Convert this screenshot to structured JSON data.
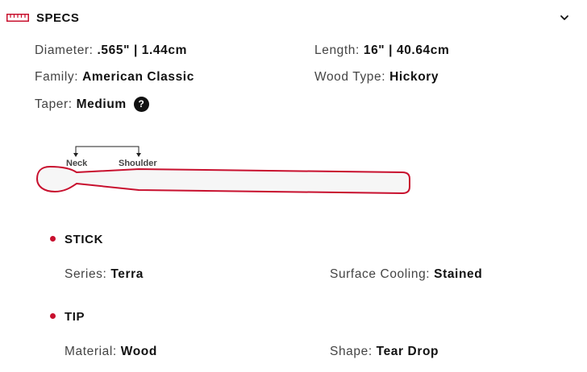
{
  "header": {
    "title": "SPECS",
    "icon": "ruler-icon",
    "toggle_icon": "chevron-down-icon",
    "accent_color": "#c8102e"
  },
  "specs": {
    "diameter": {
      "label": "Diameter:",
      "value": ".565\" | 1.44cm"
    },
    "length": {
      "label": "Length:",
      "value": "16\" | 40.64cm"
    },
    "family": {
      "label": "Family:",
      "value": "American Classic"
    },
    "wood_type": {
      "label": "Wood Type:",
      "value": "Hickory"
    },
    "taper": {
      "label": "Taper:",
      "value": "Medium",
      "help_icon": "question-icon",
      "help_glyph": "?"
    }
  },
  "diagram": {
    "neck_label": "Neck",
    "shoulder_label": "Shoulder",
    "outline_color": "#c8102e"
  },
  "sections": [
    {
      "title": "STICK",
      "items": [
        {
          "label": "Series:",
          "value": "Terra"
        },
        {
          "label": "Surface Cooling:",
          "value": "Stained"
        }
      ]
    },
    {
      "title": "TIP",
      "items": [
        {
          "label": "Material:",
          "value": "Wood"
        },
        {
          "label": "Shape:",
          "value": "Tear Drop"
        }
      ]
    }
  ]
}
